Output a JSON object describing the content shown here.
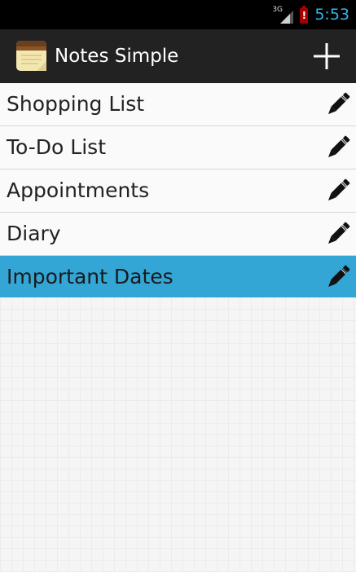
{
  "status_bar": {
    "network_type": "3G",
    "time": "5:53",
    "icons": [
      "signal-icon",
      "battery-alert-icon"
    ],
    "clock_color": "#33b5e5"
  },
  "action_bar": {
    "title": "Notes Simple",
    "app_icon": "notepad-icon",
    "add_icon": "plus-icon",
    "background": "#222222"
  },
  "notes": {
    "items": [
      {
        "title": "Shopping List",
        "selected": false
      },
      {
        "title": "To-Do List",
        "selected": false
      },
      {
        "title": "Appointments",
        "selected": false
      },
      {
        "title": "Diary",
        "selected": false
      },
      {
        "title": "Important Dates",
        "selected": true
      }
    ],
    "edit_icon": "pencil-icon",
    "selected_color": "#33a6d6"
  }
}
